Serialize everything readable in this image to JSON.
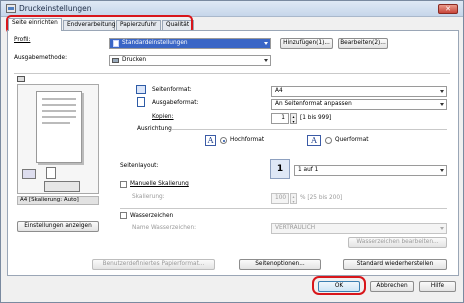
{
  "window": {
    "title": "Druckeinstellungen",
    "close_label": "✕"
  },
  "tabs": [
    {
      "label": "Seite einrichten"
    },
    {
      "label": "Endverarbeitung"
    },
    {
      "label": "Papierzufuhr"
    },
    {
      "label": "Qualität"
    }
  ],
  "profile": {
    "label": "Profil:",
    "value": "Standardeinstellungen",
    "add_button": "Hinzufügen(1)...",
    "edit_button": "Bearbeiten(2)..."
  },
  "output_method": {
    "label": "Ausgabemethode:",
    "value": "Drucken"
  },
  "preview": {
    "caption": "A4 [Skalierung: Auto]",
    "settings_button": "Einstellungen anzeigen"
  },
  "page_format": {
    "label": "Seitenformat:",
    "value": "A4"
  },
  "output_format": {
    "label": "Ausgabeformat:",
    "value": "An Seitenformat anpassen"
  },
  "copies": {
    "label": "Kopien:",
    "value": "1",
    "range": "[1 bis 999]"
  },
  "orientation": {
    "label": "Ausrichtung",
    "portrait": "Hochformat",
    "landscape": "Querformat",
    "selected": "Hochformat"
  },
  "page_layout": {
    "label": "Seitenlayout:",
    "value": "1 auf 1",
    "icon_number": "1"
  },
  "manual_scaling": {
    "label": "Manuelle Skalierung",
    "scaling_label": "Skalierung:",
    "value": "100",
    "range": "% [25 bis 200]"
  },
  "watermark": {
    "label": "Wasserzeichen",
    "name_label": "Name Wasserzeichen:",
    "name_value": "VERTRAULICH",
    "edit_button": "Wasserzeichen bearbeiten..."
  },
  "footer_buttons": {
    "custom_paper": "Benutzerdefiniertes Papierformat...",
    "page_options": "Seitenoptionen...",
    "restore_defaults": "Standard wiederherstellen"
  },
  "dialog_buttons": {
    "ok": "OK",
    "cancel": "Abbrechen",
    "help": "Hilfe"
  },
  "colors": {
    "highlight": "#3a66c6",
    "annotation_red": "#d8161b",
    "titlebar": "#c6d6ea"
  }
}
